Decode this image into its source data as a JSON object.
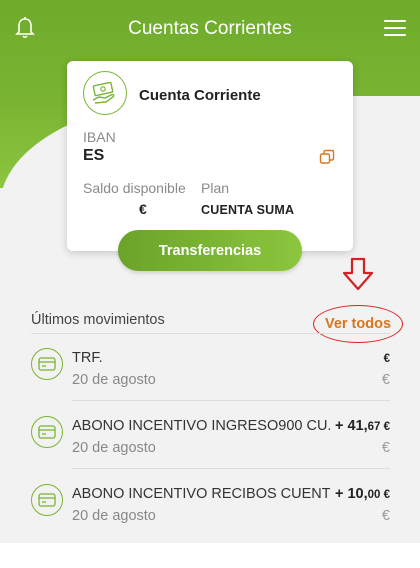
{
  "header": {
    "title": "Cuentas Corrientes",
    "left_icon": "bell-icon",
    "right_icon": "hamburger-menu-icon",
    "color": "#7ab432"
  },
  "account_card": {
    "icon": "cash-hand-icon",
    "title": "Cuenta Corriente",
    "iban_label": "IBAN",
    "iban_value": "ES",
    "copy_icon": "copy-icon",
    "saldo_label": "Saldo disponible",
    "saldo_value": "€",
    "plan_label": "Plan",
    "plan_value": "CUENTA SUMA"
  },
  "actions": {
    "transfer_label": "Transferencias"
  },
  "movements_section": {
    "title": "Últimos movimientos",
    "see_all_label": "Ver todos",
    "see_all_color": "#d7761e",
    "annotation_color": "#d22222"
  },
  "movements": [
    {
      "icon": "card-icon",
      "description": "TRF.",
      "date": "20 de agosto",
      "amount_int": "",
      "amount_dec": "",
      "amount_cur": "€",
      "balance": "€"
    },
    {
      "icon": "card-icon",
      "description": "ABONO INCENTIVO INGRESO900 CU...",
      "date": "20 de agosto",
      "amount_int": "+ 41,",
      "amount_dec": "67",
      "amount_cur": " €",
      "balance": "€"
    },
    {
      "icon": "card-icon",
      "description": "ABONO INCENTIVO RECIBOS CUENT...",
      "date": "20 de agosto",
      "amount_int": "+ 10,",
      "amount_dec": "00",
      "amount_cur": " €",
      "balance": "€"
    }
  ]
}
